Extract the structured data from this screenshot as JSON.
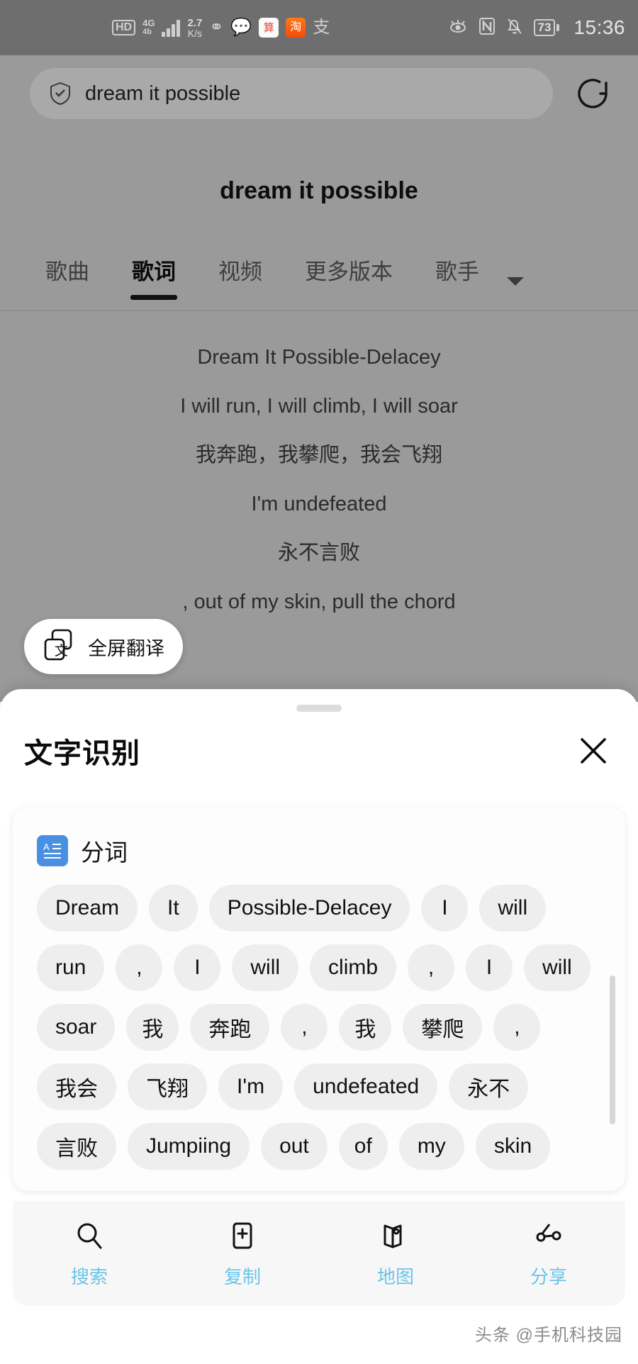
{
  "status_bar": {
    "hd_label": "HD",
    "network_label": "4G",
    "network_sub": "4b",
    "speed_value": "2.7",
    "speed_unit": "K/s",
    "icons": [
      "bluetooth-icon",
      "message-icon",
      "calculator-app-icon",
      "taobao-app-icon",
      "alipay-icon"
    ],
    "app_white_glyph": "算",
    "app_orange_glyph": "淘",
    "alipay_glyph": "支",
    "right_icons": [
      "eye-comfort-icon",
      "nfc-icon",
      "mute-icon"
    ],
    "battery_level": "73",
    "clock": "15:36"
  },
  "search": {
    "value": "dream it possible",
    "shield_icon": "shield-check-icon",
    "refresh_icon": "refresh-icon"
  },
  "page": {
    "title": "dream it possible"
  },
  "tabs": {
    "items": [
      {
        "label": "歌曲",
        "active": false
      },
      {
        "label": "歌词",
        "active": true
      },
      {
        "label": "视频",
        "active": false
      },
      {
        "label": "更多版本",
        "active": false
      },
      {
        "label": "歌手",
        "active": false
      }
    ],
    "expand_icon": "chevron-down-icon"
  },
  "lyrics": {
    "lines": [
      "Dream It Possible-Delacey",
      "I will run, I will climb, I will soar",
      "我奔跑，我攀爬，我会飞翔",
      "I'm undefeated",
      "永不言败",
      ", out of my skin, pull the chord"
    ]
  },
  "fullscreen_translate": {
    "label": "全屏翻译",
    "icon": "translate-icon"
  },
  "sheet": {
    "title": "文字识别",
    "close_icon": "close-icon",
    "card": {
      "section_icon": "text-segmentation-icon",
      "section_label": "分词",
      "chips": [
        "Dream",
        "It",
        "Possible-Delacey",
        "I",
        "will",
        "run",
        ",",
        "I",
        "will",
        "climb",
        ",",
        "I",
        "will",
        "soar",
        "我",
        "奔跑",
        ",",
        "我",
        "攀爬",
        ",",
        "我会",
        "飞翔",
        "I'm",
        "undefeated",
        "永不",
        "言败",
        "Jumpiing",
        "out",
        "of",
        "my",
        "skin"
      ]
    },
    "actions": [
      {
        "icon": "search-icon",
        "label": "搜索"
      },
      {
        "icon": "copy-icon",
        "label": "复制"
      },
      {
        "icon": "map-icon",
        "label": "地图"
      },
      {
        "icon": "share-icon",
        "label": "分享"
      }
    ]
  },
  "watermark": "头条 @手机科技园",
  "colors": {
    "accent_blue": "#6cc4e8",
    "segment_icon_blue": "#4a90e2",
    "dim_overlay": "#9a9a9a"
  }
}
